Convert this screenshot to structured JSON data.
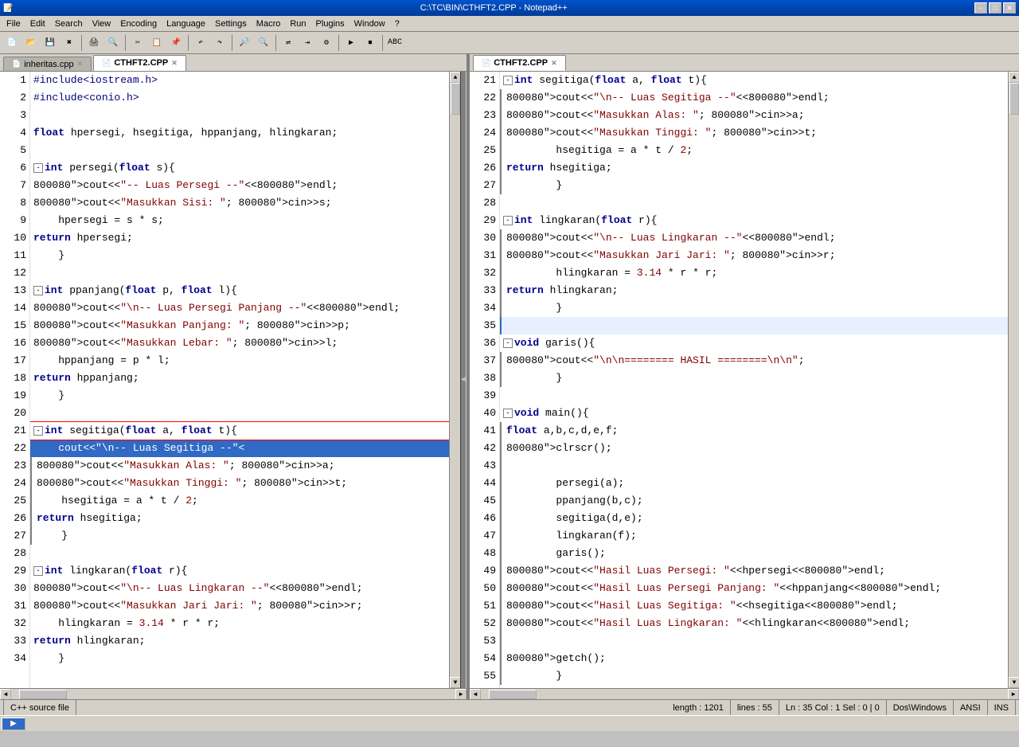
{
  "titleBar": {
    "title": "C:\\TC\\BIN\\CTHFT2.CPP - Notepad++",
    "minBtn": "−",
    "maxBtn": "□",
    "closeBtn": "✕"
  },
  "menuBar": {
    "items": [
      "File",
      "Edit",
      "Search",
      "View",
      "Encoding",
      "Language",
      "Settings",
      "Macro",
      "Run",
      "Plugins",
      "Window",
      "?"
    ]
  },
  "tabs": {
    "left": [
      {
        "label": "inheritas.cpp",
        "active": false
      },
      {
        "label": "CTHFT2.CPP",
        "active": true
      }
    ],
    "right": [
      {
        "label": "CTHFT2.CPP",
        "active": true
      }
    ]
  },
  "statusBar": {
    "fileType": "C++ source file",
    "length": "length : 1201",
    "lines": "lines : 55",
    "cursor": "Ln : 35    Col : 1    Sel : 0 | 0",
    "eol": "Dos\\Windows",
    "encoding": "ANSI",
    "ins": "INS"
  },
  "leftCode": [
    {
      "num": 1,
      "text": "#include<iostream.h>",
      "type": "include"
    },
    {
      "num": 2,
      "text": "#include<conio.h>",
      "type": "include"
    },
    {
      "num": 3,
      "text": ""
    },
    {
      "num": 4,
      "text": "float hpersegi, hsegitiga, hppanjang, hlingkaran;",
      "type": "normal"
    },
    {
      "num": 5,
      "text": ""
    },
    {
      "num": 6,
      "text": "int persegi(float s){",
      "type": "func-def",
      "collapse": true
    },
    {
      "num": 7,
      "text": "    cout<<\"-- Luas Persegi --\"<<endl;",
      "type": "normal"
    },
    {
      "num": 8,
      "text": "    cout<<\"Masukkan Sisi: \"; cin>>s;",
      "type": "normal"
    },
    {
      "num": 9,
      "text": "    hpersegi = s * s;",
      "type": "normal"
    },
    {
      "num": 10,
      "text": "    return hpersegi;",
      "type": "return"
    },
    {
      "num": 11,
      "text": "    }",
      "type": "normal"
    },
    {
      "num": 12,
      "text": ""
    },
    {
      "num": 13,
      "text": "int ppanjang(float p, float l){",
      "type": "func-def",
      "collapse": true
    },
    {
      "num": 14,
      "text": "    cout<<\"\\n-- Luas Persegi Panjang --\"<<endl;",
      "type": "normal"
    },
    {
      "num": 15,
      "text": "    cout<<\"Masukkan Panjang: \"; cin>>p;",
      "type": "normal"
    },
    {
      "num": 16,
      "text": "    cout<<\"Masukkan Lebar: \"; cin>>l;",
      "type": "normal"
    },
    {
      "num": 17,
      "text": "    hppanjang = p * l;",
      "type": "normal"
    },
    {
      "num": 18,
      "text": "    return hppanjang;",
      "type": "return"
    },
    {
      "num": 19,
      "text": "    }",
      "type": "normal"
    },
    {
      "num": 20,
      "text": ""
    },
    {
      "num": 21,
      "text": "int segitiga(float a, float t){",
      "type": "func-def",
      "collapse": true,
      "collapsed-open": true
    },
    {
      "num": 22,
      "text": "    cout<<\"\\n-- Luas Segitiga --\"<<endl;",
      "type": "selected"
    },
    {
      "num": 23,
      "text": "    cout<<\"Masukkan Alas: \"; cin>>a;",
      "type": "normal"
    },
    {
      "num": 24,
      "text": "    cout<<\"Masukkan Tinggi: \"; cin>>t;",
      "type": "normal"
    },
    {
      "num": 25,
      "text": "    hsegitiga = a * t / 2;",
      "type": "normal"
    },
    {
      "num": 26,
      "text": "    return hsegitiga;",
      "type": "return"
    },
    {
      "num": 27,
      "text": "    }",
      "type": "normal"
    },
    {
      "num": 28,
      "text": ""
    },
    {
      "num": 29,
      "text": "int lingkaran(float r){",
      "type": "func-def",
      "collapse": true
    },
    {
      "num": 30,
      "text": "    cout<<\"\\n-- Luas Lingkaran --\"<<endl;",
      "type": "normal"
    },
    {
      "num": 31,
      "text": "    cout<<\"Masukkan Jari Jari: \"; cin>>r;",
      "type": "normal"
    },
    {
      "num": 32,
      "text": "    hlingkaran = 3.14 * r * r;",
      "type": "normal"
    },
    {
      "num": 33,
      "text": "    return hlingkaran;",
      "type": "return"
    },
    {
      "num": 34,
      "text": "    }"
    }
  ],
  "rightCode": [
    {
      "num": 21,
      "text": "int segitiga(float a, float t){",
      "type": "func-def",
      "collapse": true
    },
    {
      "num": 22,
      "text": "        cout<<\"\\n-- Luas Segitiga --\"<<endl;",
      "type": "normal"
    },
    {
      "num": 23,
      "text": "        cout<<\"Masukkan Alas: \"; cin>>a;",
      "type": "normal"
    },
    {
      "num": 24,
      "text": "        cout<<\"Masukkan Tinggi: \"; cin>>t;",
      "type": "normal"
    },
    {
      "num": 25,
      "text": "        hsegitiga = a * t / 2;",
      "type": "normal"
    },
    {
      "num": 26,
      "text": "        return hsegitiga;",
      "type": "return"
    },
    {
      "num": 27,
      "text": "        }",
      "type": "normal"
    },
    {
      "num": 28,
      "text": ""
    },
    {
      "num": 29,
      "text": "int lingkaran(float r){",
      "type": "func-def",
      "collapse": true
    },
    {
      "num": 30,
      "text": "        cout<<\"\\n-- Luas Lingkaran --\"<<endl;",
      "type": "normal"
    },
    {
      "num": 31,
      "text": "        cout<<\"Masukkan Jari Jari: \"; cin>>r;",
      "type": "normal"
    },
    {
      "num": 32,
      "text": "        hlingkaran = 3.14 * r * r;",
      "type": "normal"
    },
    {
      "num": 33,
      "text": "        return hlingkaran;",
      "type": "return"
    },
    {
      "num": 34,
      "text": "        }",
      "type": "normal"
    },
    {
      "num": 35,
      "text": ""
    },
    {
      "num": 36,
      "text": "void garis(){",
      "type": "func-def",
      "collapse": true
    },
    {
      "num": 37,
      "text": "        cout<<\"\\n\\n======== HASIL ========\\n\\n\";",
      "type": "normal"
    },
    {
      "num": 38,
      "text": "        }",
      "type": "normal"
    },
    {
      "num": 39,
      "text": ""
    },
    {
      "num": 40,
      "text": "void main(){",
      "type": "func-def",
      "collapse": true
    },
    {
      "num": 41,
      "text": "        float a,b,c,d,e,f;",
      "type": "normal"
    },
    {
      "num": 42,
      "text": "        clrscr();",
      "type": "normal"
    },
    {
      "num": 43,
      "text": ""
    },
    {
      "num": 44,
      "text": "        persegi(a);",
      "type": "normal"
    },
    {
      "num": 45,
      "text": "        ppanjang(b,c);",
      "type": "normal"
    },
    {
      "num": 46,
      "text": "        segitiga(d,e);",
      "type": "normal"
    },
    {
      "num": 47,
      "text": "        lingkaran(f);",
      "type": "normal"
    },
    {
      "num": 48,
      "text": "        garis();",
      "type": "normal"
    },
    {
      "num": 49,
      "text": "        cout<<\"Hasil Luas Persegi: \"<<hpersegi<<endl;",
      "type": "normal"
    },
    {
      "num": 50,
      "text": "        cout<<\"Hasil Luas Persegi Panjang: \"<<hppanjang<<endl;",
      "type": "normal"
    },
    {
      "num": 51,
      "text": "        cout<<\"Hasil Luas Segitiga: \"<<hsegitiga<<endl;",
      "type": "normal"
    },
    {
      "num": 52,
      "text": "        cout<<\"Hasil Luas Lingkaran: \"<<hlingkaran<<endl;",
      "type": "normal"
    },
    {
      "num": 53,
      "text": ""
    },
    {
      "num": 54,
      "text": "        getch();",
      "type": "normal"
    },
    {
      "num": 55,
      "text": "        }",
      "type": "normal"
    }
  ]
}
